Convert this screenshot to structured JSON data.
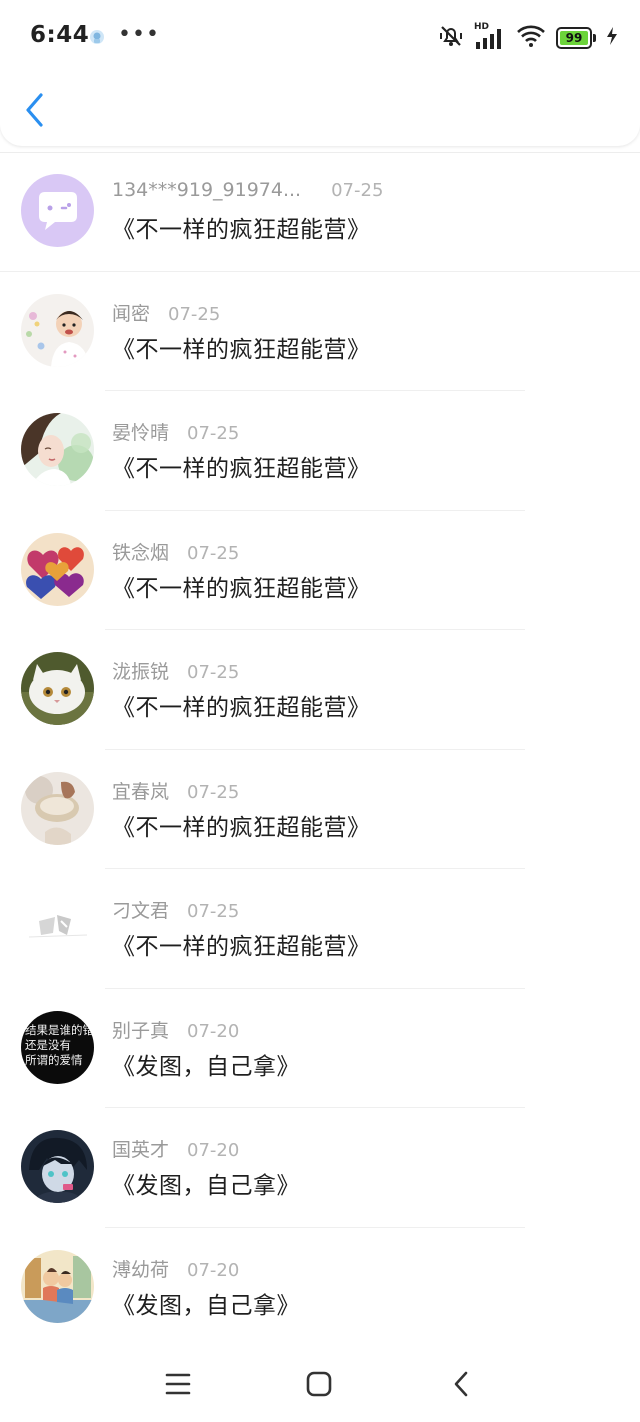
{
  "status_bar": {
    "time": "6:44",
    "dots": "•••",
    "battery_level": "99",
    "network_label": "HD"
  },
  "nav": {
    "back_icon": "chevron-left-icon",
    "accent_color": "#2a8ff0"
  },
  "list": {
    "items": [
      {
        "name": "134***919_91974...",
        "date": "07-25",
        "title": "《不一样的疯狂超能营》",
        "avatar": "chat-bubble-avatar"
      },
      {
        "name": "闻密",
        "date": "07-25",
        "title": "《不一样的疯狂超能营》",
        "avatar": "baby-photo-avatar"
      },
      {
        "name": "晏怜晴",
        "date": "07-25",
        "title": "《不一样的疯狂超能营》",
        "avatar": "portrait-avatar"
      },
      {
        "name": "铁念烟",
        "date": "07-25",
        "title": "《不一样的疯狂超能营》",
        "avatar": "hearts-avatar"
      },
      {
        "name": "泷振锐",
        "date": "07-25",
        "title": "《不一样的疯狂超能营》",
        "avatar": "cat-avatar"
      },
      {
        "name": "宜春岚",
        "date": "07-25",
        "title": "《不一样的疯狂超能营》",
        "avatar": "hand-avatar"
      },
      {
        "name": "刁文君",
        "date": "07-25",
        "title": "《不一样的疯狂超能营》",
        "avatar": "sketch-avatar"
      },
      {
        "name": "别子真",
        "date": "07-20",
        "title": "《发图，自己拿》",
        "avatar": "text-avatar",
        "avatar_text": [
          "结果是谁的错",
          "还是没有",
          "所谓的爱情"
        ]
      },
      {
        "name": "国英才",
        "date": "07-20",
        "title": "《发图，自己拿》",
        "avatar": "anime-avatar"
      },
      {
        "name": "溥幼荷",
        "date": "07-20",
        "title": "《发图，自己拿》",
        "avatar": "illustration-avatar"
      }
    ]
  },
  "system_nav": {
    "menu_icon": "menu-icon",
    "home_icon": "home-icon",
    "back_icon": "back-icon"
  }
}
